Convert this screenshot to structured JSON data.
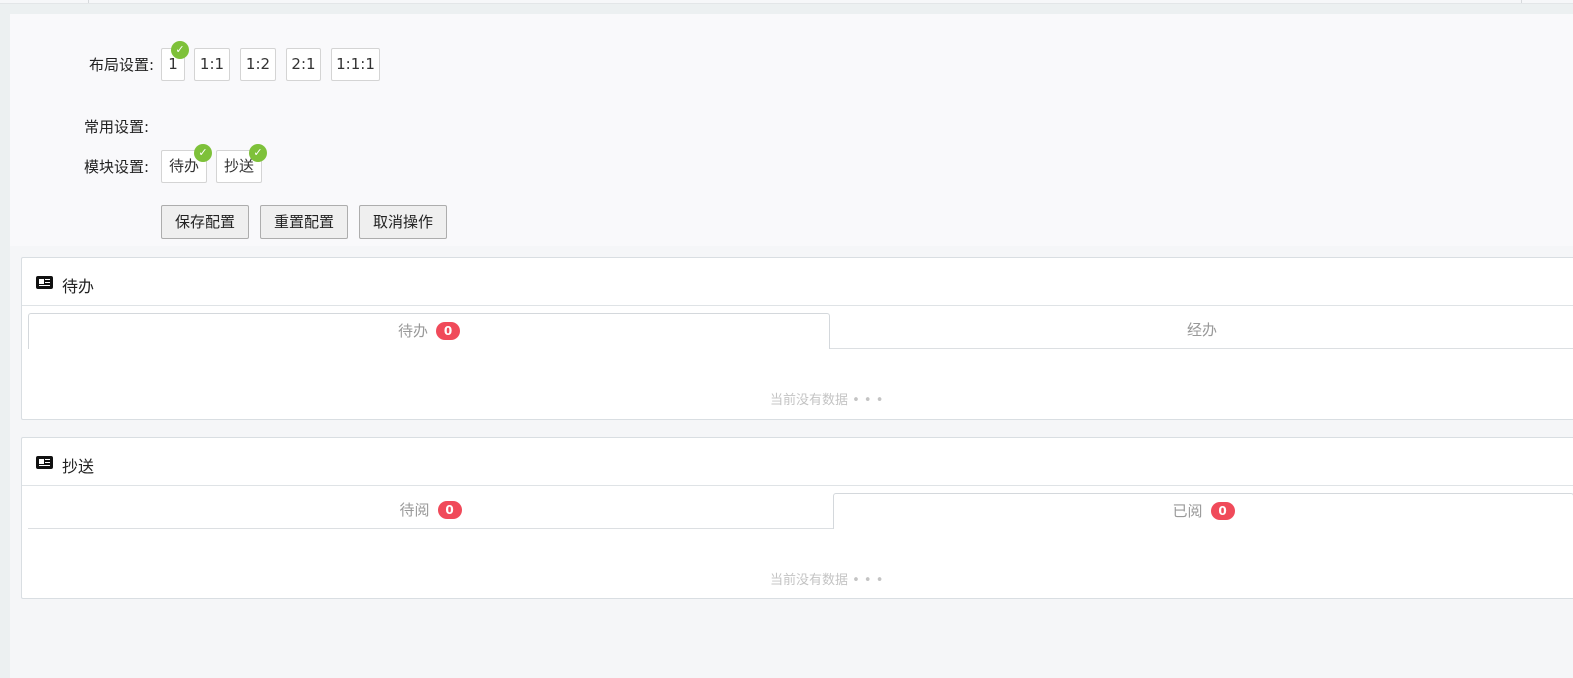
{
  "config": {
    "layout_label": "布局设置:",
    "layout_options": [
      "1",
      "1:1",
      "1:2",
      "2:1",
      "1:1:1"
    ],
    "common_label": "常用设置:",
    "module_label": "模块设置:",
    "module_options": [
      "待办",
      "抄送"
    ],
    "buttons": {
      "save": "保存配置",
      "reset": "重置配置",
      "cancel": "取消操作"
    },
    "selected_layout": "1",
    "selected_modules": [
      "待办",
      "抄送"
    ],
    "check_color": "#7ec13a",
    "check_glyph": "✓"
  },
  "panels": [
    {
      "title": "待办",
      "icon": "id-card-icon",
      "tabs": [
        {
          "label": "待办",
          "badge": "0",
          "active": true
        },
        {
          "label": "经办",
          "badge": null,
          "active": false
        }
      ],
      "empty_text": "当前没有数据 • • •"
    },
    {
      "title": "抄送",
      "icon": "id-card-icon",
      "tabs": [
        {
          "label": "待阅",
          "badge": "0",
          "active": false
        },
        {
          "label": "已阅",
          "badge": "0",
          "active": true
        }
      ],
      "empty_text": "当前没有数据 • • •"
    }
  ],
  "colors": {
    "badge": "#f04a5a",
    "page_bg": "#f5f6f8"
  }
}
